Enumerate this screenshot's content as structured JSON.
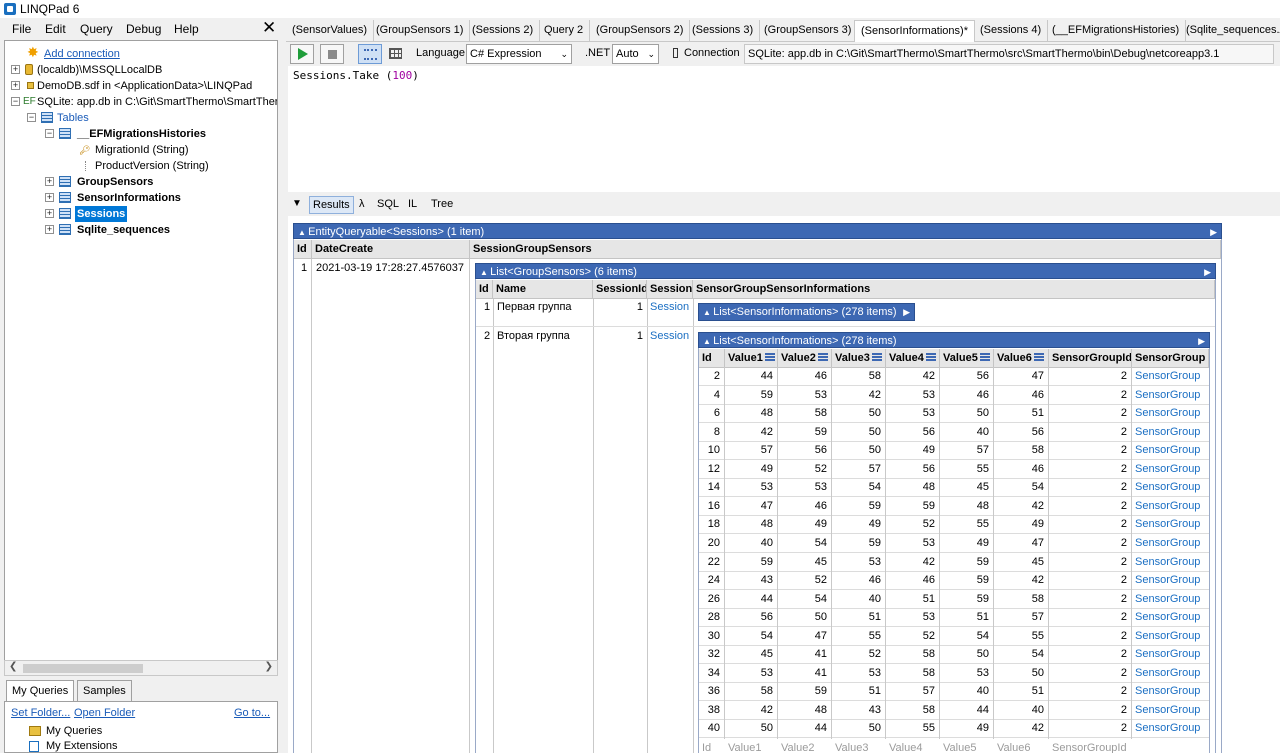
{
  "app": {
    "title": "LINQPad 6"
  },
  "menu": [
    "File",
    "Edit",
    "Query",
    "Debug",
    "Help"
  ],
  "tree": {
    "add_connection": "Add connection",
    "connections": [
      "(localdb)\\MSSQLLocalDB",
      "DemoDB.sdf in <ApplicationData>\\LINQPad",
      "SQLite: app.db in C:\\Git\\SmartThermo\\SmartTher"
    ],
    "ef_tag": "EF",
    "tables_label": "Tables",
    "efmig": "__EFMigrationsHistories",
    "efmig_cols": [
      "MigrationId (String)",
      "ProductVersion (String)"
    ],
    "other_tables": [
      "GroupSensors",
      "SensorInformations",
      "Sessions",
      "Sqlite_sequences"
    ]
  },
  "left_tabs": [
    "My Queries",
    "Samples"
  ],
  "left_links": {
    "set_folder": "Set Folder...",
    "open_folder": "Open Folder",
    "goto": "Go to..."
  },
  "my_queries": [
    "My Queries",
    "My Extensions"
  ],
  "query_tabs": [
    "(SensorValues)",
    "(GroupSensors 1)",
    "(Sessions 2)",
    "Query 2",
    "(GroupSensors 2)",
    "(Sessions 3)",
    "(GroupSensors 3)",
    "(SensorInformations)*",
    "(Sessions 4)",
    "(__EFMigrationsHistories)",
    "(Sqlite_sequences.A"
  ],
  "toolbar": {
    "language_label": "Language",
    "language_value": "C# Expression",
    "net_label": ".NET",
    "net_value": "Auto",
    "connection_label": "Connection",
    "connection_value": "SQLite: app.db in C:\\Git\\SmartThermo\\SmartThermo\\src\\SmartThermo\\bin\\Debug\\netcoreapp3.1"
  },
  "editor": {
    "code_prefix": "Sessions.Take (",
    "code_num": "100",
    "code_suffix": ")"
  },
  "result_tabs": [
    "Results",
    "λ",
    "SQL",
    "IL",
    "Tree"
  ],
  "results": {
    "outer_header": "EntityQueryable<Sessions> (1 item)",
    "outer_cols": [
      "Id",
      "DateCreate",
      "SessionGroupSensors"
    ],
    "outer_row": {
      "id": "1",
      "date": "2021-03-19 17:28:27.4576037"
    },
    "groups_header": "List<GroupSensors> (6 items)",
    "groups_cols": [
      "Id",
      "Name",
      "SessionId",
      "Session",
      "SensorGroupSensorInformations"
    ],
    "groups_rows": [
      {
        "id": "1",
        "name": "Первая группа",
        "session_id": "1",
        "session": "Session",
        "list": "List<SensorInformations> (278 items)"
      },
      {
        "id": "2",
        "name": "Вторая группа",
        "session_id": "1",
        "session": "Session",
        "list": "List<SensorInformations> (278 items)"
      }
    ],
    "sensor_cols": [
      "Id",
      "Value1",
      "Value2",
      "Value3",
      "Value4",
      "Value5",
      "Value6",
      "SensorGroupId",
      "SensorGroup"
    ],
    "sensor_rows": [
      [
        2,
        44,
        46,
        58,
        42,
        56,
        47,
        2
      ],
      [
        4,
        59,
        53,
        42,
        53,
        46,
        46,
        2
      ],
      [
        6,
        48,
        58,
        50,
        53,
        50,
        51,
        2
      ],
      [
        8,
        42,
        59,
        50,
        56,
        40,
        56,
        2
      ],
      [
        10,
        57,
        56,
        50,
        49,
        57,
        58,
        2
      ],
      [
        12,
        49,
        52,
        57,
        56,
        55,
        46,
        2
      ],
      [
        14,
        53,
        53,
        54,
        48,
        45,
        54,
        2
      ],
      [
        16,
        47,
        46,
        59,
        59,
        48,
        42,
        2
      ],
      [
        18,
        48,
        49,
        49,
        52,
        55,
        49,
        2
      ],
      [
        20,
        40,
        54,
        59,
        53,
        49,
        47,
        2
      ],
      [
        22,
        59,
        45,
        53,
        42,
        59,
        45,
        2
      ],
      [
        24,
        43,
        52,
        46,
        46,
        59,
        42,
        2
      ],
      [
        26,
        44,
        54,
        40,
        51,
        59,
        58,
        2
      ],
      [
        28,
        56,
        50,
        51,
        53,
        51,
        57,
        2
      ],
      [
        30,
        54,
        47,
        55,
        52,
        54,
        55,
        2
      ],
      [
        32,
        45,
        41,
        52,
        58,
        50,
        54,
        2
      ],
      [
        34,
        53,
        41,
        53,
        58,
        53,
        50,
        2
      ],
      [
        36,
        58,
        59,
        51,
        57,
        40,
        51,
        2
      ],
      [
        38,
        42,
        48,
        43,
        58,
        44,
        40,
        2
      ],
      [
        40,
        50,
        44,
        50,
        55,
        49,
        42,
        2
      ]
    ],
    "sensor_group_link": "SensorGroup"
  }
}
